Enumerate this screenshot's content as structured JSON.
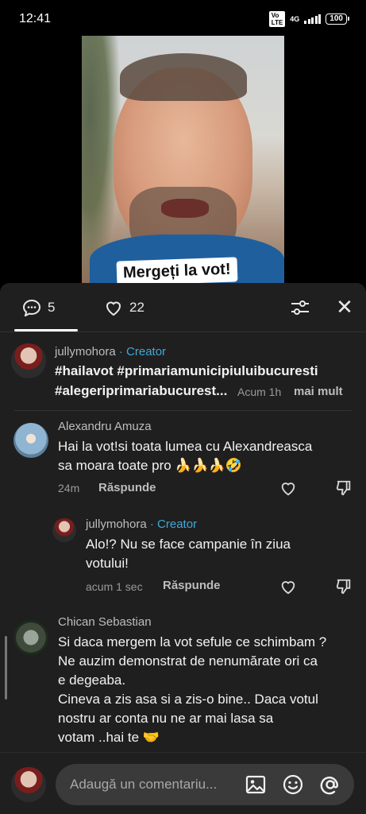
{
  "status_bar": {
    "time": "12:41",
    "volte": "Vo LTE",
    "network": "4G",
    "battery": "100"
  },
  "video": {
    "caption": "Mergeți la vot!"
  },
  "panel": {
    "comments_count": "5",
    "likes_count": "22",
    "icons": {
      "comments": "comment-icon",
      "likes": "heart-icon",
      "filter": "sliders-icon",
      "close": "close-icon"
    }
  },
  "comments": [
    {
      "username": "jullymohora",
      "badge": "· Creator",
      "line1": "#hailavot #primariamunicipiuluibucuresti",
      "line2": "#alegeriprimariabucurest...",
      "time": "Acum 1h",
      "more": "mai mult"
    },
    {
      "username": "Alexandru Amuza",
      "line1": "Hai la vot!si toata lumea cu Alexandreasca",
      "line2": "sa moara toate pro 🍌🍌🍌🤣",
      "time": "24m",
      "reply": "Răspunde"
    },
    {
      "username": "jullymohora",
      "badge": "· Creator",
      "line1": "Alo!? Nu se face campanie în ziua",
      "line2": "votului!",
      "time": "acum 1 sec",
      "reply": "Răspunde"
    },
    {
      "username": "Chican Sebastian",
      "line1": "Si daca mergem la vot sefule ce schimbam ?",
      "line2": "Ne auzim demonstrat de nenumărate ori ca",
      "line3": "e degeaba.",
      "line4": "Cineva a zis asa si a zis-o bine.. Daca votul",
      "line5": "nostru ar conta nu ne ar mai lasa sa",
      "line6": "votam ..hai te 🤝"
    }
  ],
  "footer": {
    "placeholder": "Adaugă un comentariu...",
    "icons": {
      "image": "image-icon",
      "emoji": "emoji-icon",
      "mention": "at-icon"
    }
  }
}
